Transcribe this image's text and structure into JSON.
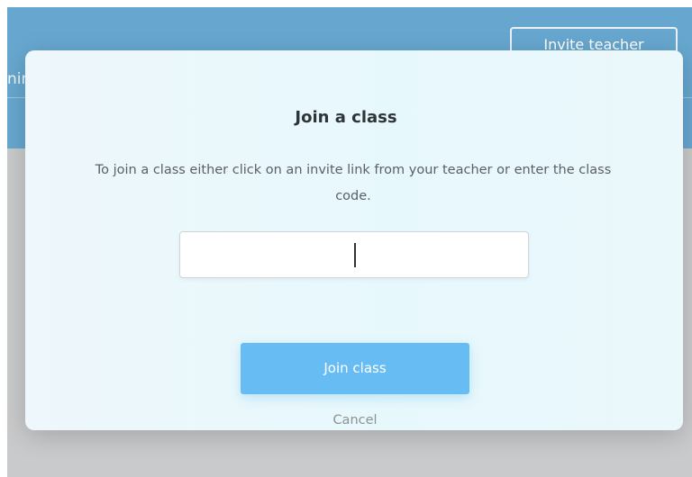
{
  "background": {
    "header_left_text": "nin",
    "invite_button_label": "Invite teacher"
  },
  "modal": {
    "title": "Join a class",
    "description": "To join a class either click on an invite link from your teacher or enter the class code.",
    "code_input": {
      "value": "",
      "placeholder": ""
    },
    "join_button_label": "Join class",
    "cancel_label": "Cancel"
  },
  "colors": {
    "header": "#67a7cf",
    "overlay": "#c9cacb",
    "modal_bg": "#e7f8fc",
    "join_button": "#67bdf3"
  }
}
